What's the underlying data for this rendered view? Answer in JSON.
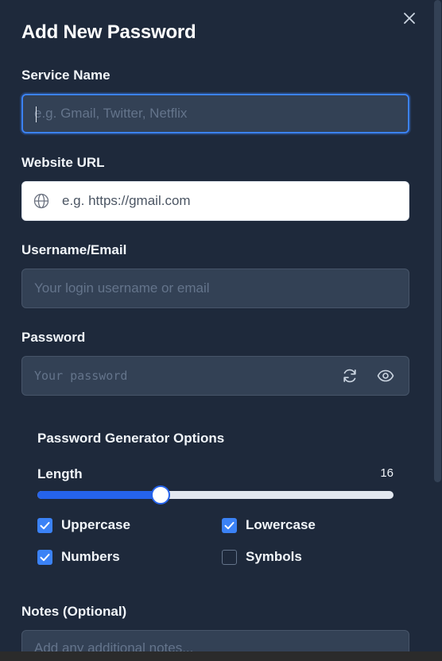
{
  "modal": {
    "title": "Add New Password",
    "close_icon": "close-icon"
  },
  "service": {
    "label": "Service Name",
    "value": "",
    "placeholder": "e.g. Gmail, Twitter, Netflix"
  },
  "website": {
    "label": "Website URL",
    "icon": "globe-icon",
    "value": "",
    "placeholder": "e.g. https://gmail.com"
  },
  "username": {
    "label": "Username/Email",
    "value": "",
    "placeholder": "Your login username or email"
  },
  "password": {
    "label": "Password",
    "value": "",
    "placeholder": "Your password",
    "regenerate_icon": "refresh-icon",
    "visibility_icon": "eye-icon"
  },
  "generator": {
    "title": "Password Generator Options",
    "length_label": "Length",
    "length_value": "16",
    "length_fraction": 0.345,
    "options": [
      {
        "label": "Uppercase",
        "checked": true
      },
      {
        "label": "Lowercase",
        "checked": true
      },
      {
        "label": "Numbers",
        "checked": true
      },
      {
        "label": "Symbols",
        "checked": false
      }
    ]
  },
  "notes": {
    "label": "Notes (Optional)",
    "value": "",
    "placeholder": "Add any additional notes..."
  },
  "colors": {
    "background": "#1e293b",
    "input_background": "#334155",
    "accent": "#3b82f6",
    "slider_fill": "#2563eb"
  }
}
